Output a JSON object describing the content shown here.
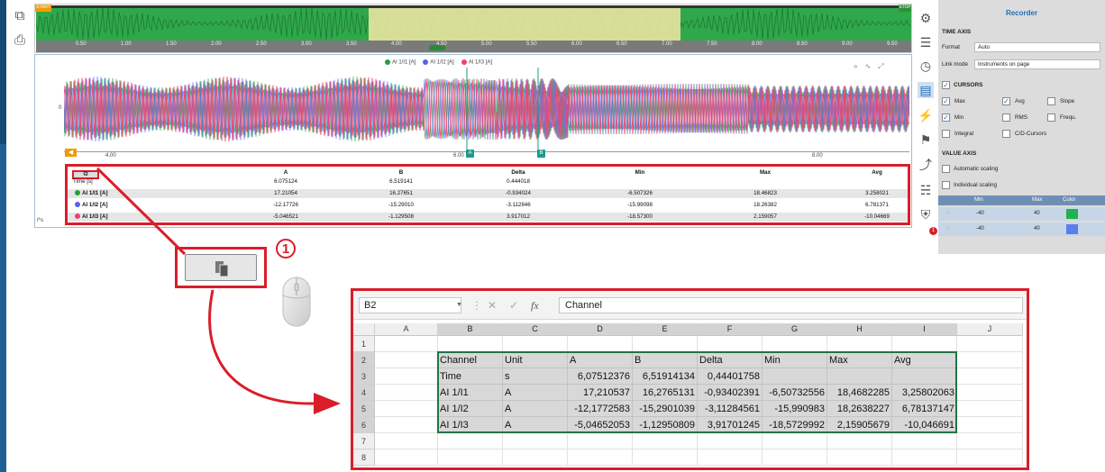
{
  "overview": {
    "start_label": "START",
    "stop_label": "STOP",
    "ticks": [
      "0.50",
      "1.00",
      "1.50",
      "2.00",
      "2.50",
      "3.00",
      "3.50",
      "4.00",
      "4.50",
      "5.00",
      "5.50",
      "6.00",
      "6.50",
      "7.00",
      "7.50",
      "8.00",
      "8.50",
      "9.00",
      "9.50"
    ]
  },
  "plot": {
    "legend": [
      {
        "name": "AI 1/I1 [A]",
        "color": "#22a039"
      },
      {
        "name": "AI 1/I2 [A]",
        "color": "#5a5ef0"
      },
      {
        "name": "AI 1/I3 [A]",
        "color": "#ef3f70"
      }
    ],
    "x_ticks": [
      "4.00",
      "6.00",
      "8.00"
    ],
    "y_zero": "0",
    "cursor_a": "A",
    "cursor_b": "B",
    "foot_label": "I*s"
  },
  "cursor_table": {
    "headers": [
      "A",
      "B",
      "Delta",
      "Min",
      "Max",
      "Avg"
    ],
    "rows": [
      {
        "label": "Time [s]",
        "color": "",
        "values": [
          "6.075124",
          "6.519141",
          "0.444018",
          "",
          "",
          ""
        ]
      },
      {
        "label": "AI 1/I1 [A]",
        "color": "#22a039",
        "values": [
          "17.21054",
          "16.27651",
          "-0.934024",
          "-6.507326",
          "18.46823",
          "3.258021"
        ]
      },
      {
        "label": "AI 1/I2 [A]",
        "color": "#5a5ef0",
        "values": [
          "-12.17726",
          "-15.29010",
          "-3.112846",
          "-15.99098",
          "18.26382",
          "6.781371"
        ]
      },
      {
        "label": "AI 1/I3 [A]",
        "color": "#ef3f70",
        "values": [
          "-5.046521",
          "-1.129508",
          "3.917012",
          "-18.57300",
          "2.159057",
          "-10.04669"
        ]
      }
    ]
  },
  "panel": {
    "title": "Recorder",
    "time_axis": "TIME AXIS",
    "format_label": "Format",
    "format_value": "Auto",
    "linkmode_label": "Link mode",
    "linkmode_value": "Instruments on page",
    "cursors_label": "CURSORS",
    "checks": [
      {
        "label": "Max",
        "checked": true
      },
      {
        "label": "Avg",
        "checked": true
      },
      {
        "label": "Slope",
        "checked": false
      },
      {
        "label": "Min",
        "checked": true
      },
      {
        "label": "RMS",
        "checked": false
      },
      {
        "label": "Frequ.",
        "checked": false
      },
      {
        "label": "Integral",
        "checked": false
      },
      {
        "label": "C/D-Cursors",
        "checked": false
      }
    ],
    "value_axis": "VALUE AXIS",
    "auto_scaling": "Automatic scaling",
    "indiv_scaling": "Individual scaling",
    "axis_headers": [
      "Min",
      "Max",
      "Color"
    ],
    "axis_rows": [
      {
        "min": "-40",
        "max": "40",
        "color": "#22b14c"
      },
      {
        "min": "-40",
        "max": "40",
        "color": "#5a7df0"
      }
    ]
  },
  "callout_number": "1",
  "excel": {
    "name_box": "B2",
    "formula": "Channel",
    "col_headers": [
      "A",
      "B",
      "C",
      "D",
      "E",
      "F",
      "G",
      "H",
      "I",
      "J"
    ],
    "row_headers": [
      "1",
      "2",
      "3",
      "4",
      "5",
      "6",
      "7",
      "8"
    ],
    "rows": [
      [
        "",
        "",
        "",
        "",
        "",
        "",
        "",
        ""
      ],
      [
        "Channel",
        "Unit",
        "A",
        "B",
        "Delta",
        "Min",
        "Max",
        "Avg"
      ],
      [
        "Time",
        "s",
        "6,07512376",
        "6,51914134",
        "0,44401758",
        "",
        "",
        ""
      ],
      [
        "AI 1/I1",
        "A",
        "17,210537",
        "16,2765131",
        "-0,93402391",
        "-6,50732556",
        "18,4682285",
        "3,25802063"
      ],
      [
        "AI 1/I2",
        "A",
        "-12,1772583",
        "-15,2901039",
        "-3,11284561",
        "-15,990983",
        "18,2638227",
        "6,78137147"
      ],
      [
        "AI 1/I3",
        "A",
        "-5,04652053",
        "-1,12950809",
        "3,91701245",
        "-18,5729992",
        "2,15905679",
        "-10,046691"
      ],
      [
        "",
        "",
        "",
        "",
        "",
        "",
        "",
        ""
      ],
      [
        "",
        "",
        "",
        "",
        "",
        "",
        "",
        ""
      ]
    ]
  }
}
